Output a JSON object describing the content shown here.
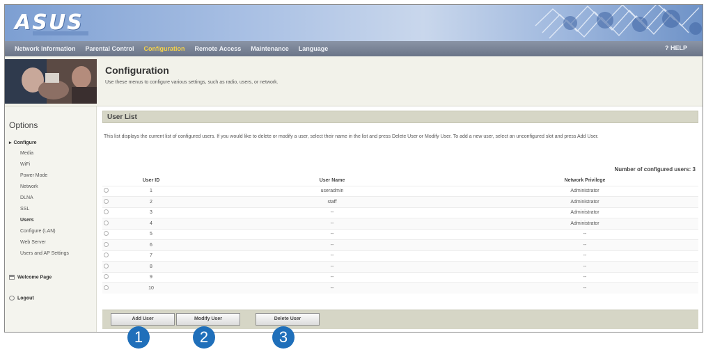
{
  "header": {
    "logo": "ASUS"
  },
  "nav": {
    "items": [
      {
        "label": "Network Information",
        "active": false
      },
      {
        "label": "Parental Control",
        "active": false
      },
      {
        "label": "Configuration",
        "active": true
      },
      {
        "label": "Remote Access",
        "active": false
      },
      {
        "label": "Maintenance",
        "active": false
      },
      {
        "label": "Language",
        "active": false
      }
    ],
    "help": "? HELP"
  },
  "banner": {
    "title": "Configuration",
    "description": "Use these menus to configure various settings, such as radio, users, or network."
  },
  "sidebar": {
    "title": "Options",
    "items": [
      {
        "label": "Configure",
        "level": 0
      },
      {
        "label": "Media",
        "level": 1
      },
      {
        "label": "WiFi",
        "level": 1
      },
      {
        "label": "Power Mode",
        "level": 1
      },
      {
        "label": "Network",
        "level": 1
      },
      {
        "label": "DLNA",
        "level": 1
      },
      {
        "label": "SSL",
        "level": 1
      },
      {
        "label": "Users",
        "level": 1
      },
      {
        "label": "Configure (LAN)",
        "level": 1
      },
      {
        "label": "Web Server",
        "level": 1
      },
      {
        "label": "Users and AP Settings",
        "level": 1
      },
      {
        "label": "Welcome Page",
        "level": 0
      },
      {
        "label": "Logout",
        "level": 0
      }
    ]
  },
  "user_list": {
    "title": "User List",
    "description": "This list displays the current list of configured users. If you would like to delete or modify a user, select their name in the list and press Delete User or Modify User. To add a new user, select an unconfigured slot and press Add User.",
    "count_label": "Number of configured users: 3",
    "columns": [
      "User ID",
      "User Name",
      "Network Privilege"
    ],
    "rows": [
      {
        "id": "1",
        "name": "useradmin",
        "privilege": "Administrator"
      },
      {
        "id": "2",
        "name": "staff",
        "privilege": "Administrator"
      },
      {
        "id": "3",
        "name": "--",
        "privilege": "Administrator"
      },
      {
        "id": "4",
        "name": "--",
        "privilege": "Administrator"
      },
      {
        "id": "5",
        "name": "--",
        "privilege": "--"
      },
      {
        "id": "6",
        "name": "--",
        "privilege": "--"
      },
      {
        "id": "7",
        "name": "--",
        "privilege": "--"
      },
      {
        "id": "8",
        "name": "--",
        "privilege": "--"
      },
      {
        "id": "9",
        "name": "--",
        "privilege": "--"
      },
      {
        "id": "10",
        "name": "--",
        "privilege": "--"
      }
    ]
  },
  "buttons": {
    "add": "Add User",
    "modify": "Modify User",
    "delete": "Delete User"
  },
  "callouts": [
    "1",
    "2",
    "3"
  ],
  "colors": {
    "callout": "#1f6fba",
    "nav_active": "#f5d34a",
    "section_bar": "#d6d6c6"
  }
}
